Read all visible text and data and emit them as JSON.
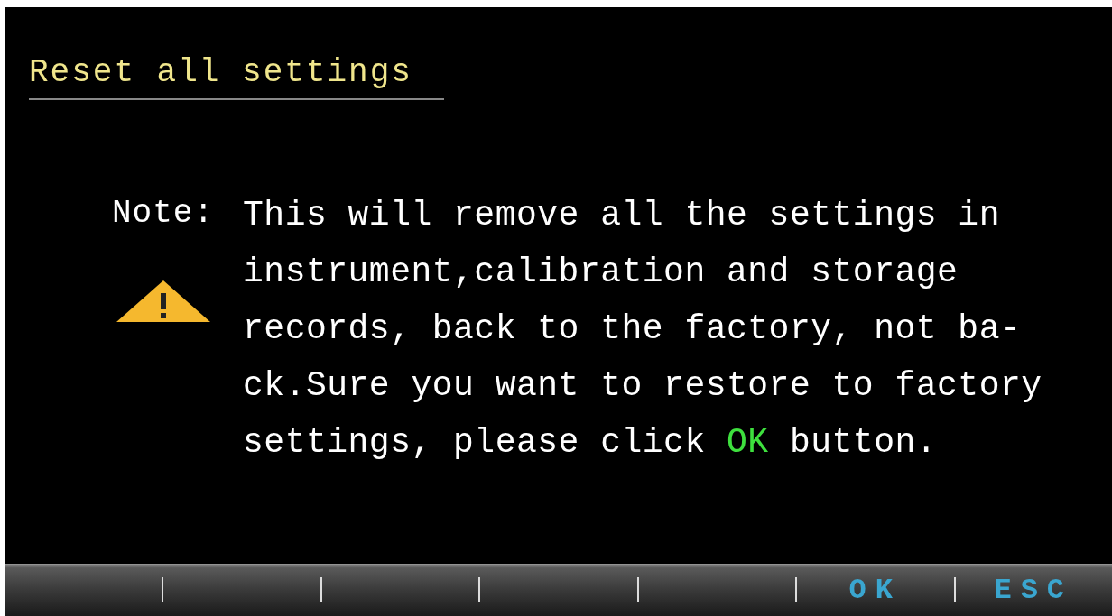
{
  "title": "Reset all settings",
  "note_label": "Note:",
  "message_lines": [
    [
      {
        "text": "This will remove all the settings in",
        "highlight": false
      }
    ],
    [
      {
        "text": "instrument,calibration and storage",
        "highlight": false
      }
    ],
    [
      {
        "text": "records, back to the factory, not ba-",
        "highlight": false
      }
    ],
    [
      {
        "text": "ck.Sure you want to restore to factory",
        "highlight": false
      }
    ],
    [
      {
        "text": "settings, please click ",
        "highlight": false
      },
      {
        "text": "OK",
        "highlight": true
      },
      {
        "text": " button.",
        "highlight": false
      }
    ]
  ],
  "softkeys": [
    {
      "kind": "blank"
    },
    {
      "kind": "blank"
    },
    {
      "kind": "blank"
    },
    {
      "kind": "blank"
    },
    {
      "kind": "blank"
    },
    {
      "kind": "key",
      "label": "OK"
    },
    {
      "kind": "key",
      "label": "ESC"
    }
  ]
}
